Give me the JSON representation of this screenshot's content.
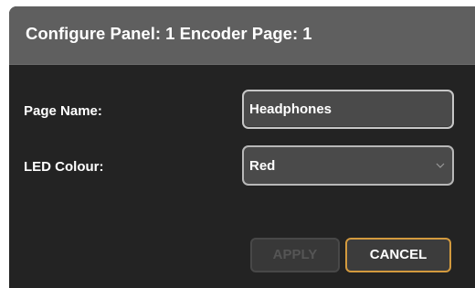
{
  "dialog": {
    "title": "Configure Panel: 1 Encoder Page: 1",
    "page_name": {
      "label": "Page Name:",
      "value": "Headphones"
    },
    "led_colour": {
      "label": "LED Colour:",
      "selected": "Red",
      "icon": "chevron-down-icon"
    },
    "buttons": {
      "apply": "APPLY",
      "cancel": "CANCEL"
    }
  },
  "colors": {
    "dialog_background": "#232323",
    "header_background": "#5f5f5f",
    "cancel_border": "#d39a3e",
    "disabled_text": "#555555"
  }
}
